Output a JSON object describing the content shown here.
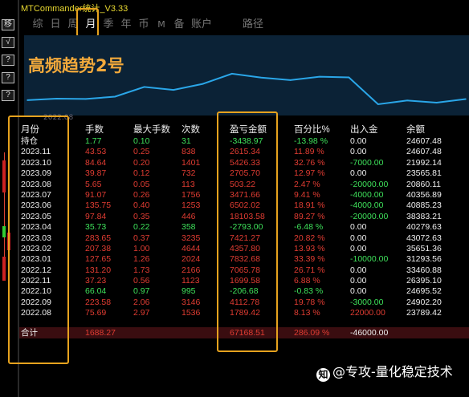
{
  "app": {
    "title": "MTCommander统计_V3.33"
  },
  "side_toolbar": {
    "buttons": [
      "移",
      "√",
      "?",
      "?",
      "?"
    ]
  },
  "tabs": [
    {
      "label": "综",
      "active": false
    },
    {
      "label": "日",
      "active": false
    },
    {
      "label": "周",
      "active": false
    },
    {
      "label": "月",
      "active": true
    },
    {
      "label": "季",
      "active": false
    },
    {
      "label": "年",
      "active": false
    },
    {
      "label": "币",
      "active": false
    },
    {
      "label": "M",
      "active": false
    },
    {
      "label": "备",
      "active": false
    },
    {
      "label": "账户",
      "active": false
    },
    {
      "label": "路径",
      "active": false
    }
  ],
  "chart_data": {
    "type": "line",
    "title": "高频趋势2号",
    "x_start_label": "2022.08",
    "x": [
      "2022.08",
      "2022.09",
      "2022.10",
      "2022.11",
      "2022.12",
      "2023.01",
      "2023.02",
      "2023.03",
      "2023.04",
      "2023.05",
      "2023.06",
      "2023.07",
      "2023.08",
      "2023.09",
      "2023.10",
      "2023.11"
    ],
    "y": [
      23789.42,
      24902.2,
      24695.52,
      26395.1,
      33460.88,
      31293.56,
      35651.36,
      43072.63,
      40279.63,
      38383.21,
      40885.23,
      40356.89,
      20860.11,
      23565.81,
      21992.14,
      24607.48
    ],
    "series_color": "#2aa6e8",
    "background": "#0b2236"
  },
  "table": {
    "headers": {
      "month": "月份",
      "trades": "手数",
      "max_lots": "最大手数",
      "count": "次数",
      "pl": "盈亏金额",
      "pct": "百分比%",
      "flow": "出入金",
      "balance": "余额"
    },
    "hold": {
      "month": "持仓",
      "trades": "1.77",
      "max_lots": "0.10",
      "count": "31",
      "pl": "-3438.97",
      "pct": "-13.98 %",
      "flow": "0.00",
      "balance": "24607.48"
    },
    "rows": [
      {
        "month": "2023.11",
        "trades": "43.53",
        "max_lots": "0.25",
        "count": "838",
        "pl": "2615.34",
        "pct": "11.89 %",
        "flow": "0.00",
        "balance": "24607.48",
        "up": true,
        "flow_sign": "zero"
      },
      {
        "month": "2023.10",
        "trades": "84.64",
        "max_lots": "0.20",
        "count": "1401",
        "pl": "5426.33",
        "pct": "32.76 %",
        "flow": "-7000.00",
        "balance": "21992.14",
        "up": true,
        "flow_sign": "neg"
      },
      {
        "month": "2023.09",
        "trades": "39.87",
        "max_lots": "0.12",
        "count": "732",
        "pl": "2705.70",
        "pct": "12.97 %",
        "flow": "0.00",
        "balance": "23565.81",
        "up": true,
        "flow_sign": "zero"
      },
      {
        "month": "2023.08",
        "trades": "5.65",
        "max_lots": "0.05",
        "count": "113",
        "pl": "503.22",
        "pct": "2.47 %",
        "flow": "-20000.00",
        "balance": "20860.11",
        "up": true,
        "flow_sign": "neg"
      },
      {
        "month": "2023.07",
        "trades": "91.07",
        "max_lots": "0.26",
        "count": "1756",
        "pl": "3471.66",
        "pct": "9.41 %",
        "flow": "-4000.00",
        "balance": "40356.89",
        "up": true,
        "flow_sign": "neg"
      },
      {
        "month": "2023.06",
        "trades": "135.75",
        "max_lots": "0.40",
        "count": "1253",
        "pl": "6502.02",
        "pct": "18.91 %",
        "flow": "-4000.00",
        "balance": "40885.23",
        "up": true,
        "flow_sign": "neg"
      },
      {
        "month": "2023.05",
        "trades": "97.84",
        "max_lots": "0.35",
        "count": "446",
        "pl": "18103.58",
        "pct": "89.27 %",
        "flow": "-20000.00",
        "balance": "38383.21",
        "up": true,
        "flow_sign": "neg"
      },
      {
        "month": "2023.04",
        "trades": "35.73",
        "max_lots": "0.22",
        "count": "358",
        "pl": "-2793.00",
        "pct": "-6.48 %",
        "flow": "0.00",
        "balance": "40279.63",
        "up": false,
        "flow_sign": "zero"
      },
      {
        "month": "2023.03",
        "trades": "283.65",
        "max_lots": "0.37",
        "count": "3235",
        "pl": "7421.27",
        "pct": "20.82 %",
        "flow": "0.00",
        "balance": "43072.63",
        "up": true,
        "flow_sign": "zero"
      },
      {
        "month": "2023.02",
        "trades": "207.38",
        "max_lots": "1.00",
        "count": "4644",
        "pl": "4357.80",
        "pct": "13.93 %",
        "flow": "0.00",
        "balance": "35651.36",
        "up": true,
        "flow_sign": "zero"
      },
      {
        "month": "2023.01",
        "trades": "127.65",
        "max_lots": "1.26",
        "count": "2024",
        "pl": "7832.68",
        "pct": "33.39 %",
        "flow": "-10000.00",
        "balance": "31293.56",
        "up": true,
        "flow_sign": "neg"
      },
      {
        "month": "2022.12",
        "trades": "131.20",
        "max_lots": "1.73",
        "count": "2166",
        "pl": "7065.78",
        "pct": "26.71 %",
        "flow": "0.00",
        "balance": "33460.88",
        "up": true,
        "flow_sign": "zero"
      },
      {
        "month": "2022.11",
        "trades": "37.23",
        "max_lots": "0.56",
        "count": "1123",
        "pl": "1699.58",
        "pct": "6.88 %",
        "flow": "0.00",
        "balance": "26395.10",
        "up": true,
        "flow_sign": "zero"
      },
      {
        "month": "2022.10",
        "trades": "66.04",
        "max_lots": "0.97",
        "count": "995",
        "pl": "-206.68",
        "pct": "-0.83 %",
        "flow": "0.00",
        "balance": "24695.52",
        "up": false,
        "flow_sign": "zero"
      },
      {
        "month": "2022.09",
        "trades": "223.58",
        "max_lots": "2.06",
        "count": "3146",
        "pl": "4112.78",
        "pct": "19.78 %",
        "flow": "-3000.00",
        "balance": "24902.20",
        "up": true,
        "flow_sign": "neg"
      },
      {
        "month": "2022.08",
        "trades": "75.69",
        "max_lots": "2.97",
        "count": "1536",
        "pl": "1789.42",
        "pct": "8.13 %",
        "flow": "22000.00",
        "balance": "23789.42",
        "up": true,
        "flow_sign": "pos"
      }
    ],
    "total": {
      "month": "合计",
      "trades": "1688.27",
      "pl": "67168.51",
      "pct": "286.09 %",
      "flow": "-46000.00"
    }
  },
  "watermark": {
    "icon": "zhihu-icon",
    "text": "@专攻-量化稳定技术"
  },
  "colors": {
    "highlight_box": "#e6a21e",
    "profit": "#e03c32",
    "loss": "#3ee05a",
    "title": "#e8d830"
  }
}
